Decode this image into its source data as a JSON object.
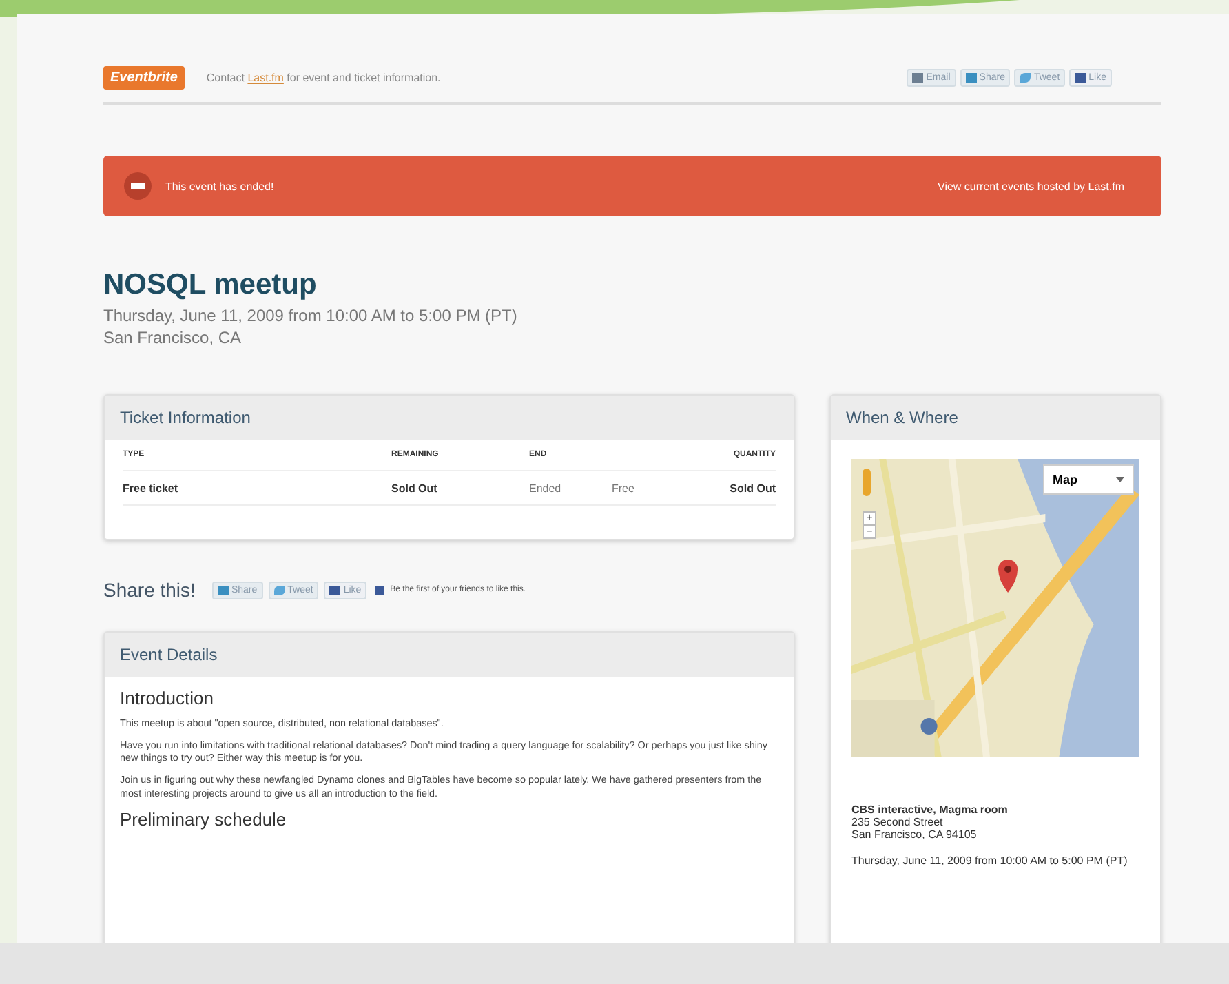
{
  "header": {
    "logo": "Eventbrite",
    "contact_prefix": "Contact ",
    "contact_link": "Last.fm",
    "contact_suffix": " for event and ticket information.",
    "share_buttons": [
      {
        "kind": "email",
        "label": "Email"
      },
      {
        "kind": "share",
        "label": "Share"
      },
      {
        "kind": "tweet",
        "label": "Tweet"
      },
      {
        "kind": "like",
        "label": "Like"
      }
    ]
  },
  "banner": {
    "message": "This event has ended!",
    "link": "View current events hosted by Last.fm"
  },
  "event": {
    "title": "NOSQL meetup",
    "date": "Thursday, June 11, 2009 from 10:00 AM to 5:00 PM (PT)",
    "location": "San Francisco, CA"
  },
  "ticket_information": {
    "title": "Ticket Information",
    "columns": [
      "TYPE",
      "REMAINING",
      "END",
      "QUANTITY"
    ],
    "rows": [
      {
        "type": "Free ticket",
        "remaining": "Sold Out",
        "end": "Ended",
        "price": "Free",
        "quantity": "Sold Out"
      }
    ]
  },
  "share": {
    "label": "Share this!",
    "buttons": [
      {
        "kind": "share",
        "label": "Share"
      },
      {
        "kind": "tweet",
        "label": "Tweet"
      },
      {
        "kind": "like",
        "label": "Like"
      }
    ],
    "facebook_text": "Be the first of your friends to like this."
  },
  "event_details": {
    "title": "Event Details",
    "heading": "Introduction",
    "paragraphs": [
      "This meetup is about \"open source, distributed, non relational databases\".",
      "Have you run into limitations with traditional relational databases? Don't mind trading a query language for scalability? Or perhaps you just like shiny new things to try out? Either way this meetup is for you.",
      "Join us in figuring out why these newfangled Dynamo clones and BigTables have become so popular lately. We have gathered presenters from the most interesting projects around to give us all an introduction to the field."
    ],
    "subheading": "Preliminary schedule"
  },
  "when_where": {
    "title": "When & Where",
    "map": {
      "kind": "picture",
      "map_type": "Map",
      "zoom_in": "+",
      "zoom_out": "−"
    },
    "venue": "CBS interactive, Magma room",
    "street": "235 Second Street",
    "city": "San Francisco, CA 94105",
    "date": "Thursday, June 11, 2009 from 10:00 AM to 5:00 PM (PT)"
  }
}
